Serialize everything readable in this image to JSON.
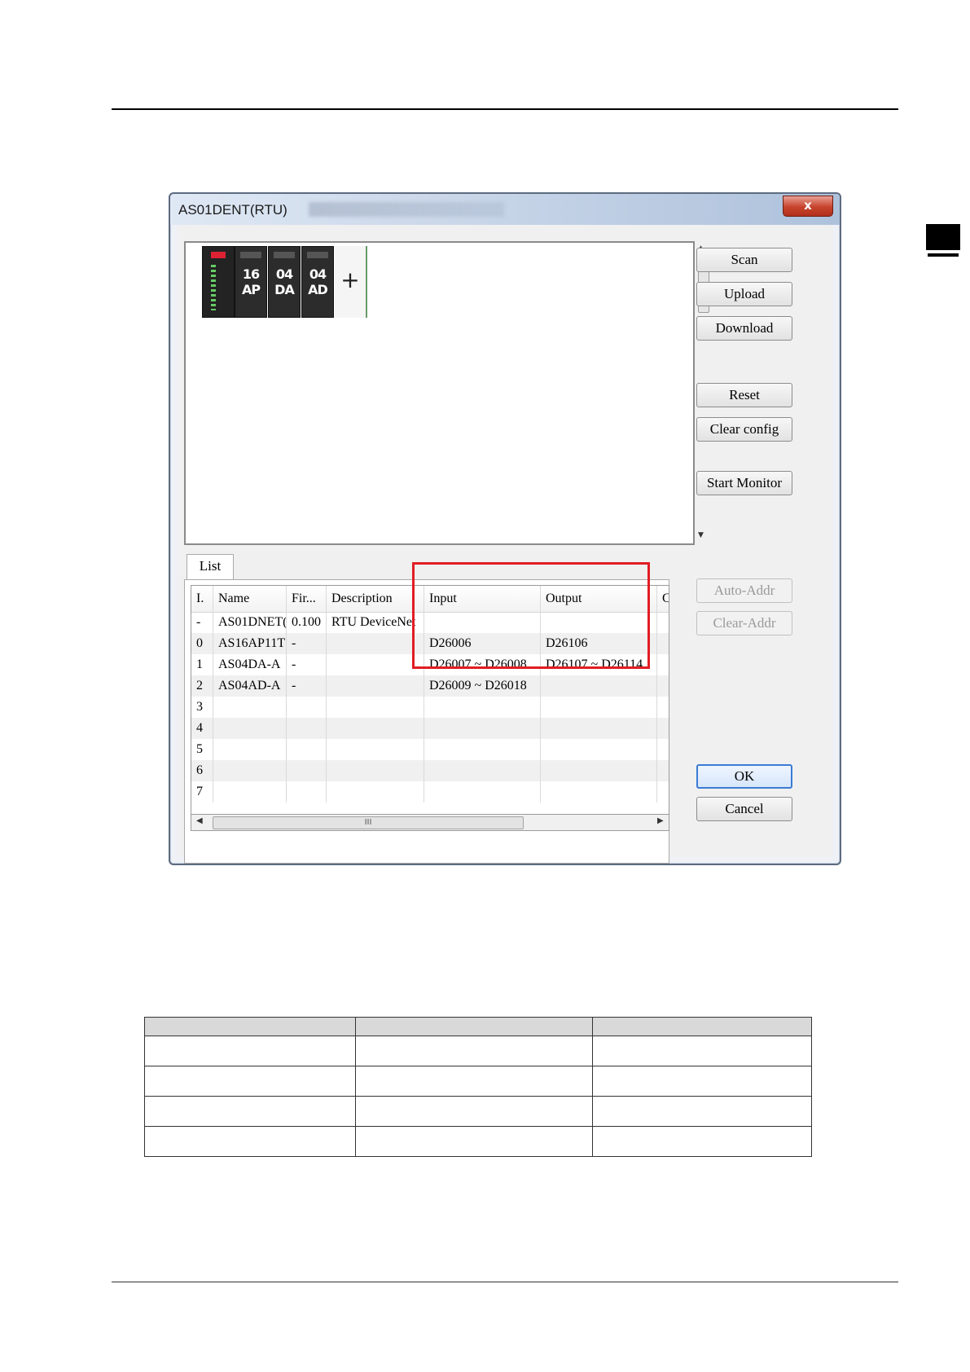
{
  "window": {
    "title": "AS01DENT(RTU)",
    "close_label": "x"
  },
  "rack": {
    "modules": [
      "16\nAP",
      "04\nDA",
      "04\nAD"
    ],
    "add_label": "+"
  },
  "buttons": {
    "scan": "Scan",
    "upload": "Upload",
    "download": "Download",
    "reset": "Reset",
    "clear_config": "Clear config",
    "start_monitor": "Start Monitor",
    "auto_addr": "Auto-Addr",
    "clear_addr": "Clear-Addr",
    "ok": "OK",
    "cancel": "Cancel"
  },
  "list": {
    "tab_label": "List",
    "columns": [
      "I.",
      "Name",
      "Fir...",
      "Description",
      "Input",
      "Output",
      "C"
    ],
    "rows": [
      [
        "-",
        "AS01DNET(",
        "0.100",
        "RTU DeviceNet",
        "",
        ""
      ],
      [
        "0",
        "AS16AP11T",
        "-",
        "",
        "D26006",
        "D26106"
      ],
      [
        "1",
        "AS04DA-A",
        "-",
        "",
        "D26007 ~ D26008",
        "D26107 ~ D26114"
      ],
      [
        "2",
        "AS04AD-A",
        "-",
        "",
        "D26009 ~ D26018",
        ""
      ],
      [
        "3",
        "",
        "",
        "",
        "",
        ""
      ],
      [
        "4",
        "",
        "",
        "",
        "",
        ""
      ],
      [
        "5",
        "",
        "",
        "",
        "",
        ""
      ],
      [
        "6",
        "",
        "",
        "",
        "",
        ""
      ],
      [
        "7",
        "",
        "",
        "",
        "",
        ""
      ]
    ],
    "scroll_grip": "III"
  },
  "colors": {
    "highlight": "#e11d24",
    "ok_focus": "#3a7bd5"
  }
}
